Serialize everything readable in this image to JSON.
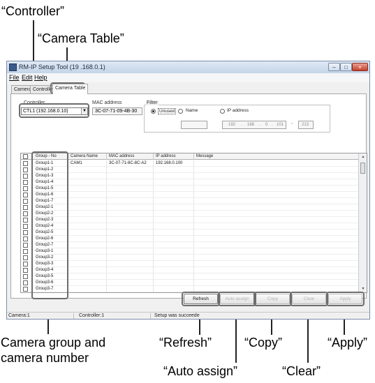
{
  "callouts": {
    "controller": "“Controller”",
    "camera_table": "“Camera Table”",
    "group_line1": "Camera group and",
    "group_line2": "camera number",
    "refresh": "“Refresh”",
    "copy": "“Copy”",
    "apply": "“Apply”",
    "auto_assign": "“Auto assign”",
    "clear": "“Clear”"
  },
  "window": {
    "title": "RM-IP    Setup Tool (19  .168.0.1)",
    "buttons": {
      "minimize": "–",
      "maximize": "□",
      "close": "×"
    }
  },
  "menu": [
    "File",
    "Edit",
    "Help"
  ],
  "tabs": [
    {
      "label": "Camera",
      "active": false
    },
    {
      "label": "Controller",
      "active": false
    },
    {
      "label": "Camera Table",
      "active": true
    }
  ],
  "controller_label": "Controller",
  "controller_value": "CTL1 (192.168.0.10)",
  "mac_label": "MAC address",
  "mac_value": "3C-07-71-09-4B-30",
  "filter": {
    "label": "Filter",
    "unused": "Unused",
    "name": "Name",
    "ip_address": "IP address",
    "ip_octets": [
      "192",
      "168",
      "0",
      "101"
    ],
    "ip_suffix_sep": "~",
    "ip_end": "213"
  },
  "table": {
    "headers": [
      "Group - No",
      "Camera Name",
      "MAC address",
      "IP address",
      "Message"
    ],
    "rows": [
      {
        "group": "Group1-1",
        "camera": "CAM1",
        "mac": "3C-07-71-8C-8C-A2",
        "ip": "192.168.0.100",
        "message": ""
      },
      {
        "group": "Group1-2",
        "camera": "",
        "mac": "",
        "ip": "",
        "message": ""
      },
      {
        "group": "Group1-3",
        "camera": "",
        "mac": "",
        "ip": "",
        "message": ""
      },
      {
        "group": "Group1-4",
        "camera": "",
        "mac": "",
        "ip": "",
        "message": ""
      },
      {
        "group": "Group1-5",
        "camera": "",
        "mac": "",
        "ip": "",
        "message": ""
      },
      {
        "group": "Group1-6",
        "camera": "",
        "mac": "",
        "ip": "",
        "message": ""
      },
      {
        "group": "Group1-7",
        "camera": "",
        "mac": "",
        "ip": "",
        "message": ""
      },
      {
        "group": "Group2-1",
        "camera": "",
        "mac": "",
        "ip": "",
        "message": ""
      },
      {
        "group": "Group2-2",
        "camera": "",
        "mac": "",
        "ip": "",
        "message": ""
      },
      {
        "group": "Group2-3",
        "camera": "",
        "mac": "",
        "ip": "",
        "message": ""
      },
      {
        "group": "Group2-4",
        "camera": "",
        "mac": "",
        "ip": "",
        "message": ""
      },
      {
        "group": "Group2-5",
        "camera": "",
        "mac": "",
        "ip": "",
        "message": ""
      },
      {
        "group": "Group2-6",
        "camera": "",
        "mac": "",
        "ip": "",
        "message": ""
      },
      {
        "group": "Group2-7",
        "camera": "",
        "mac": "",
        "ip": "",
        "message": ""
      },
      {
        "group": "Group3-1",
        "camera": "",
        "mac": "",
        "ip": "",
        "message": ""
      },
      {
        "group": "Group3-2",
        "camera": "",
        "mac": "",
        "ip": "",
        "message": ""
      },
      {
        "group": "Group3-3",
        "camera": "",
        "mac": "",
        "ip": "",
        "message": ""
      },
      {
        "group": "Group3-4",
        "camera": "",
        "mac": "",
        "ip": "",
        "message": ""
      },
      {
        "group": "Group3-5",
        "camera": "",
        "mac": "",
        "ip": "",
        "message": ""
      },
      {
        "group": "Group3-6",
        "camera": "",
        "mac": "",
        "ip": "",
        "message": ""
      },
      {
        "group": "Group3-7",
        "camera": "",
        "mac": "",
        "ip": "",
        "message": ""
      }
    ]
  },
  "buttons": {
    "refresh": "Refresh",
    "auto_assign": "Auto assign",
    "copy": "Copy",
    "clear": "Clear",
    "apply": "Apply"
  },
  "status": {
    "camera": "Camera:1",
    "controller": "Controller:1",
    "message": "Setup was succeede"
  }
}
